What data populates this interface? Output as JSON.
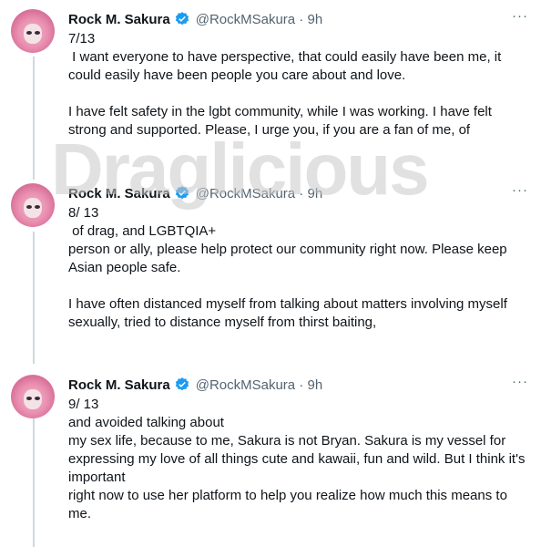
{
  "watermark": "Draglicious",
  "tweets": [
    {
      "name": "Rock M. Sakura",
      "handle": "@RockMSakura · 9h",
      "more": "···",
      "text": "7/13\n I want everyone to have perspective, that could easily have been me, it could easily have been people you care about and love.\n\nI have felt safety in the lgbt community, while I was working. I have felt strong and supported. Please, I urge you, if you are a fan of me, of"
    },
    {
      "name": "Rock M. Sakura",
      "handle": "@RockMSakura · 9h",
      "more": "···",
      "text": "8/ 13\n of drag, and LGBTQIA+\nperson or ally, please help protect our community right now. Please keep Asian people safe.\n\nI have often distanced myself from talking about matters involving myself sexually, tried to distance myself from thirst baiting,"
    },
    {
      "name": "Rock M. Sakura",
      "handle": "@RockMSakura · 9h",
      "more": "···",
      "text": "9/ 13\nand avoided talking about\nmy sex life, because to me, Sakura is not Bryan. Sakura is my vessel for expressing my love of all things cute and kawaii, fun and wild. But I think it's important\nright now to use her platform to help you realize how much this means to me."
    }
  ],
  "colors": {
    "verified": "#1d9bf0",
    "handle": "#536471",
    "thread_line": "#cfd9de"
  }
}
